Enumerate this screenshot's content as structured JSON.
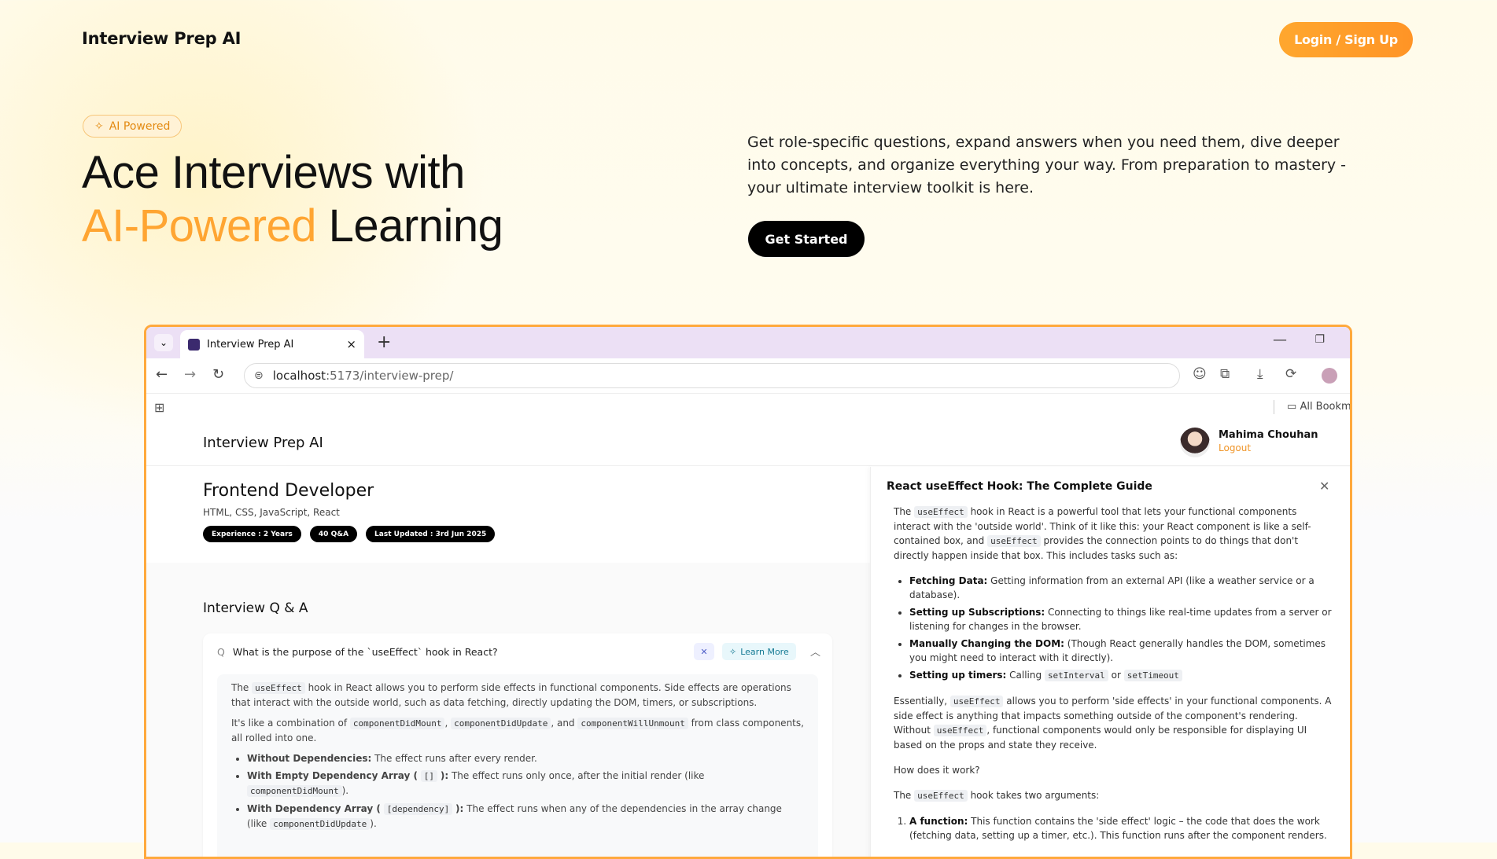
{
  "nav": {
    "title": "Interview Prep AI",
    "login_label": "Login / Sign Up"
  },
  "hero": {
    "badge": "AI Powered",
    "heading_line1": "Ace Interviews with",
    "heading_accent": "AI-Powered",
    "heading_rest": " Learning",
    "description": "Get role-specific questions, expand answers when you need them, dive deeper into concepts, and organize everything your way. From preparation to mastery - your ultimate interview toolkit is here.",
    "cta_label": "Get Started"
  },
  "browser": {
    "tab_title": "Interview Prep AI",
    "url_host": "localhost",
    "url_path": ":5173/interview-prep/",
    "bookmarks_label": "All Bookma"
  },
  "app": {
    "title": "Interview Prep AI",
    "user_name": "Mahima Chouhan",
    "logout_label": "Logout",
    "role": "Frontend Developer",
    "skills": "HTML, CSS, JavaScript, React",
    "pills": [
      "Experience : 2 Years",
      "40 Q&A",
      "Last Updated : 3rd Jun 2025"
    ],
    "qa_heading": "Interview Q & A",
    "question": "What is the purpose of the `useEffect` hook in React?",
    "learn_more": "Learn More",
    "answer": {
      "p1_a": "The ",
      "p1_code": "useEffect",
      "p1_b": " hook in React allows you to perform side effects in functional components. Side effects are operations that interact with the outside world, such as data fetching, directly updating the DOM, timers, or subscriptions.",
      "p2_a": "It's like a combination of ",
      "p2_c1": "componentDidMount",
      "p2_c2": "componentDidUpdate",
      "p2_mid": ", and ",
      "p2_c3": "componentWillUnmount",
      "p2_b": " from class components, all rolled into one.",
      "b1_bold": "Without Dependencies:",
      "b1_text": " The effect runs after every render.",
      "b2_bold": "With Empty Dependency Array (",
      "b2_code": "[]",
      "b2_bold2": "):",
      "b2_text": " The effect runs only once, after the initial render (like ",
      "b2_code2": "componentDidMount",
      "b2_end": ").",
      "b3_bold": "With Dependency Array (",
      "b3_code": "[dependency]",
      "b3_bold2": "):",
      "b3_text": " The effect runs when any of the dependencies in the array change (like ",
      "b3_code2": "componentDidUpdate",
      "b3_end": ")."
    }
  },
  "drawer": {
    "title": "React useEffect Hook: The Complete Guide",
    "intro_a": "The ",
    "intro_code": "useEffect",
    "intro_b": " hook in React is a powerful tool that lets your functional components interact with the 'outside world'. Think of it like this: your React component is like a self-contained box, and ",
    "intro_code2": "useEffect",
    "intro_c": " provides the connection points to do things that don't directly happen inside that box. This includes tasks such as:",
    "items": [
      {
        "bold": "Fetching Data:",
        "text": " Getting information from an external API (like a weather service or a database)."
      },
      {
        "bold": "Setting up Subscriptions:",
        "text": " Connecting to things like real-time updates from a server or listening for changes in the browser."
      },
      {
        "bold": "Manually Changing the DOM:",
        "text": " (Though React generally handles the DOM, sometimes you might need to interact with it directly)."
      }
    ],
    "timers_bold": "Setting up timers:",
    "timers_text": " Calling ",
    "timers_code1": "setInterval",
    "timers_or": " or ",
    "timers_code2": "setTimeout",
    "ess_a": "Essentially, ",
    "ess_code": "useEffect",
    "ess_b": " allows you to perform 'side effects' in your functional components. A side effect is anything that impacts something outside of the component's rendering. Without ",
    "ess_code2": "useEffect",
    "ess_c": ", functional components would only be responsible for displaying UI based on the props and state they receive.",
    "how": "How does it work?",
    "args_a": "The ",
    "args_code": "useEffect",
    "args_b": " hook takes two arguments:",
    "arg1_bold": "A function:",
    "arg1_text": " This function contains the 'side effect' logic – the code that does the work (fetching data, setting up a timer, etc.). This function runs after the component renders."
  }
}
